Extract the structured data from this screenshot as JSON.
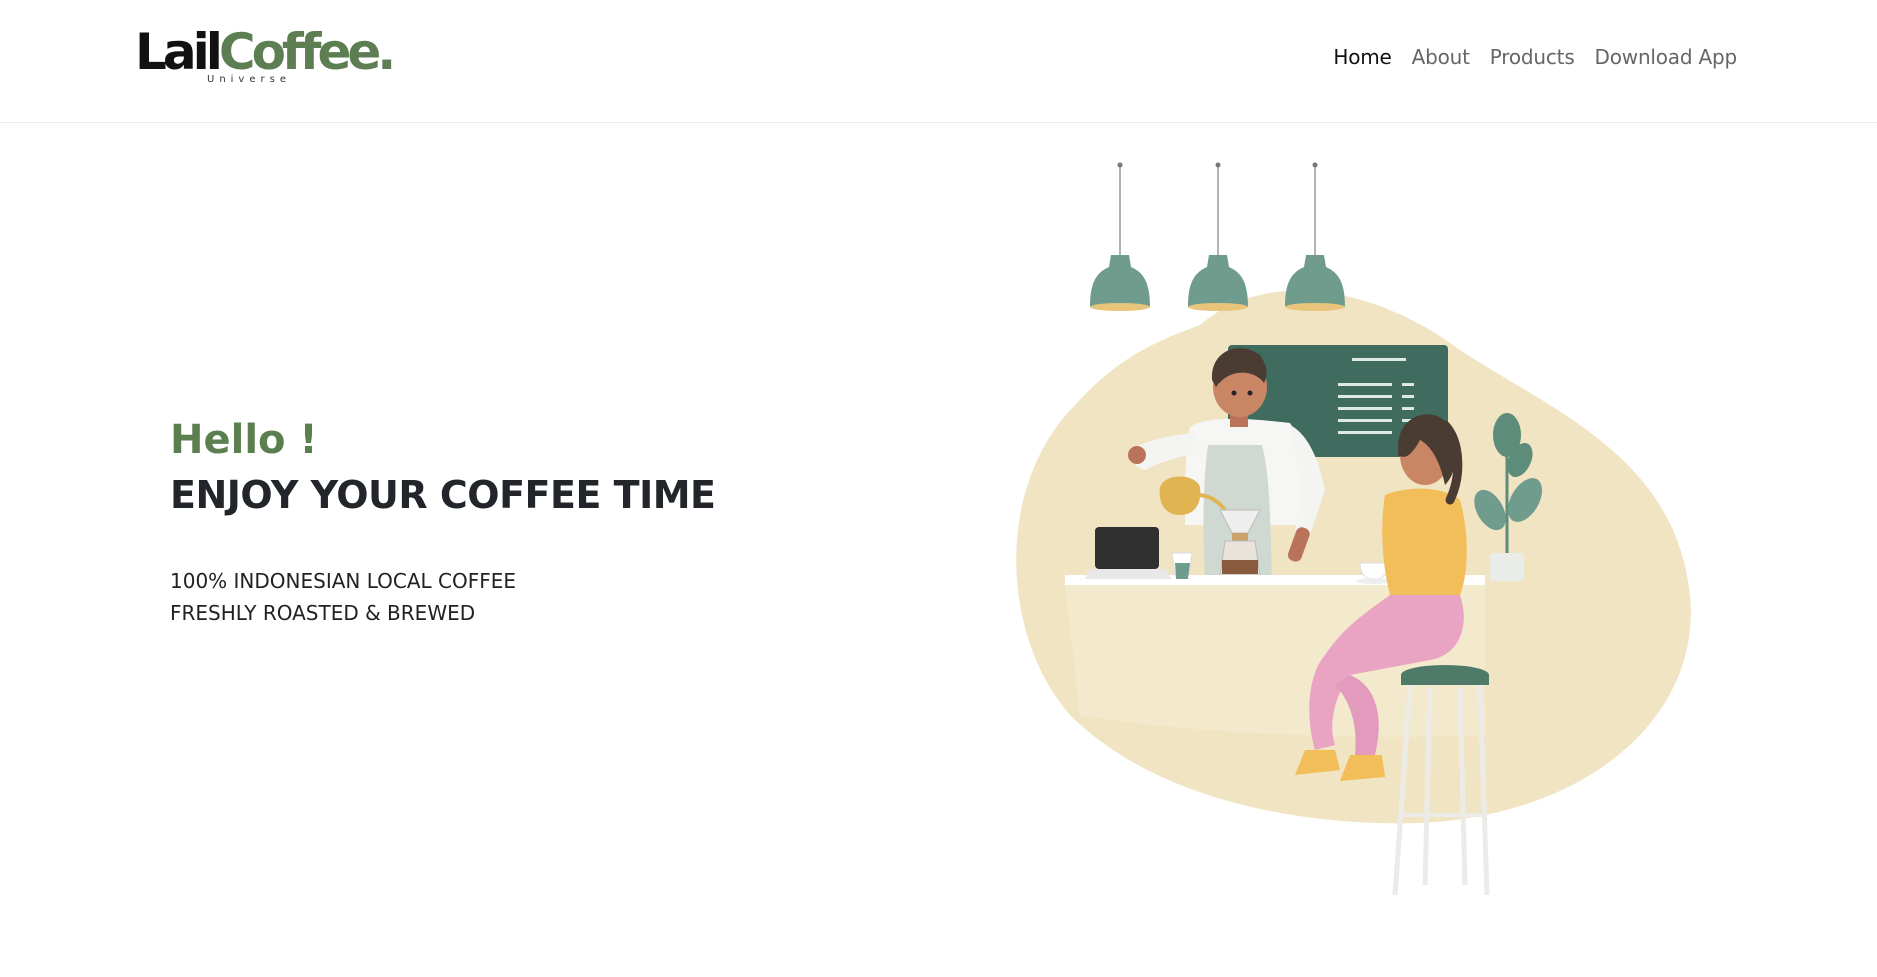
{
  "brand": {
    "part1": "Lail",
    "part2": "Coffee.",
    "tagline": "Universe"
  },
  "nav": {
    "items": [
      {
        "label": "Home",
        "active": true
      },
      {
        "label": "About",
        "active": false
      },
      {
        "label": "Products",
        "active": false
      },
      {
        "label": "Download App",
        "active": false
      }
    ]
  },
  "hero": {
    "greeting": "Hello !",
    "headline": "ENJOY YOUR COFFEE TIME",
    "line1": "100% INDONESIAN LOCAL COFFEE",
    "line2": "FRESHLY ROASTED & BREWED"
  },
  "colors": {
    "accent_green": "#5b7f4f",
    "blob": "#f1e4c3",
    "lamp": "#6f9c8c",
    "board": "#3f6c5e"
  }
}
